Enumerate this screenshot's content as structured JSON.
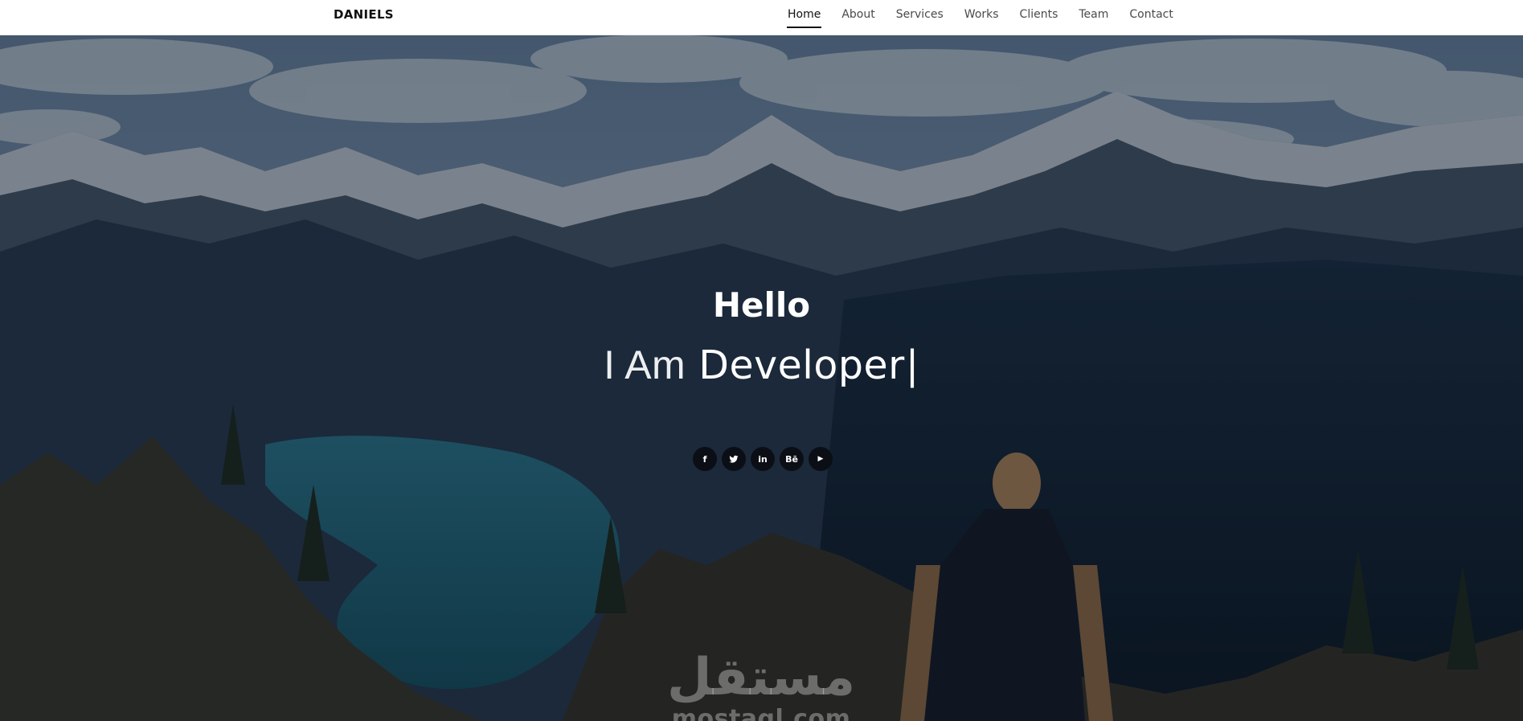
{
  "header": {
    "brand": "DANIELS",
    "nav": [
      "Home",
      "About",
      "Services",
      "Works",
      "Clients",
      "Team",
      "Contact"
    ],
    "active": "Home"
  },
  "hero": {
    "title": "Hello",
    "subtitle_lead": "I Am",
    "subtitle_word": "Developer",
    "cursor": "|",
    "social": [
      {
        "icon": "facebook-icon",
        "glyph": "f"
      },
      {
        "icon": "twitter-icon",
        "glyph": "t"
      },
      {
        "icon": "linkedin-icon",
        "glyph": "in"
      },
      {
        "icon": "behance-icon",
        "glyph": "Bē"
      },
      {
        "icon": "youtube-icon",
        "glyph": "▶"
      }
    ]
  },
  "watermark": {
    "arabic": "مستقل",
    "latin": "mostaql.com"
  },
  "colors": {
    "header_bg": "#ffffff",
    "text_dark": "#111111",
    "overlay": "#08101c",
    "hero_text": "#ffffff"
  }
}
